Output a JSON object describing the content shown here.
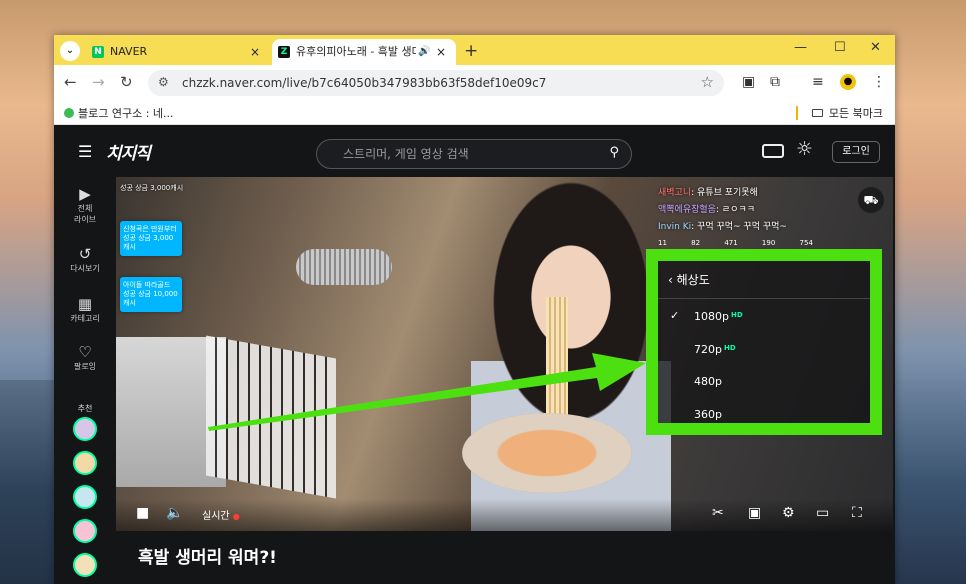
{
  "browser": {
    "tabs": [
      {
        "favicon": "N",
        "title": "NAVER",
        "close": "×"
      },
      {
        "favicon": "Z",
        "title": "유후의피아노래 - 흑발 생머",
        "speaker": "🔊",
        "close": "×"
      }
    ],
    "newtab": "+",
    "window": {
      "minimize": "—",
      "maximize": "☐",
      "close": "✕"
    },
    "toolbar": {
      "back": "←",
      "forward": "→",
      "reload": "↻",
      "url": "chzzk.naver.com/live/b7c64050b347983bb63f58def10e09c7",
      "star": "☆"
    },
    "bookmarks": {
      "left": "블로그 연구소 : 네...",
      "right": "모든 북마크"
    }
  },
  "app": {
    "logo": "치지직",
    "search_placeholder": "스트리머, 게임 영상 검색",
    "login": "로그인",
    "sidebar": [
      {
        "icon": "▶",
        "label": "전체\n라이브"
      },
      {
        "icon": "↺",
        "label": "다시보기"
      },
      {
        "icon": "▦",
        "label": "카테고리"
      },
      {
        "icon": "♡",
        "label": "팔로잉"
      }
    ],
    "recommend_label": "추천"
  },
  "player": {
    "donations": [
      {
        "title": "",
        "sub": "성공 상금 3,000캐시"
      },
      {
        "title": "신청곡은 만원부터",
        "sub": "성공 상금 3,000캐시"
      },
      {
        "title": "아이돌 따라골드",
        "sub": "성공 상금 10,000캐시"
      }
    ],
    "chat": [
      {
        "nick": "새벽고니",
        "msg": ": 유튜브 포기못해"
      },
      {
        "nick": "액뽁에유창혈음",
        "msg": ": ㄹㅇㅋㅋ"
      },
      {
        "nick": "Invin Ki",
        "msg": ": 꾸먹 꾸먹~ 꾸먹 꾸먹~"
      }
    ],
    "stats": [
      "11",
      "82",
      "471",
      "190",
      "754"
    ],
    "quality_menu": {
      "title": "해상도",
      "items": [
        {
          "label": "1080p",
          "hd": "HD",
          "selected": true
        },
        {
          "label": "720p",
          "hd": "HD",
          "selected": false
        },
        {
          "label": "480p",
          "hd": "",
          "selected": false
        },
        {
          "label": "360p",
          "hd": "",
          "selected": false
        }
      ]
    },
    "live_label": "실시간"
  },
  "stream_title": "흑발 생머리 워며?!",
  "colors": {
    "highlight": "#4ce010",
    "accent": "#00ffa3",
    "tabbar": "#f6dd53"
  }
}
